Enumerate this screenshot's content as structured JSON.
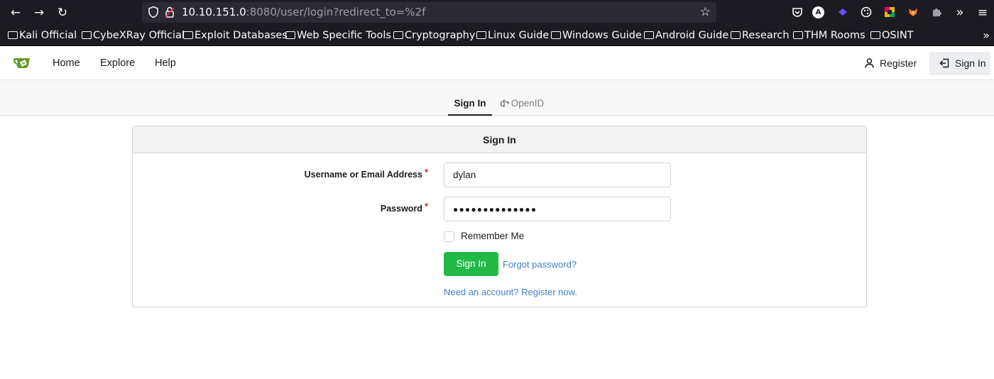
{
  "browser": {
    "url_host": "10.10.151.0",
    "url_rest": ":8080/user/login?redirect_to=%2f",
    "bookmarks": [
      "Kali Official",
      "CybeXRay Official",
      "Exploit Databases",
      "Web Specific Tools",
      "Cryptography",
      "Linux Guide",
      "Windows Guide",
      "Android Guide",
      "Research",
      "THM Rooms",
      "OSINT"
    ],
    "extension_letter": "A",
    "more_bookmarks": "»"
  },
  "site_nav": {
    "home": "Home",
    "explore": "Explore",
    "help": "Help",
    "register": "Register",
    "sign_in": "Sign In"
  },
  "tabs": {
    "sign_in": "Sign In",
    "openid": "OpenID"
  },
  "form": {
    "header": "Sign In",
    "username_label": "Username or Email Address",
    "username_value": "dylan",
    "password_label": "Password",
    "password_mask": "●●●●●●●●●●●●●●",
    "required_mark": "*",
    "remember_me": "Remember Me",
    "submit": "Sign In",
    "forgot_password": "Forgot password?",
    "register_link": "Need an account? Register now."
  },
  "colors": {
    "primary_button": "#21ba45",
    "link": "#4183c4",
    "required": "#db2828",
    "logo": "#609926"
  }
}
